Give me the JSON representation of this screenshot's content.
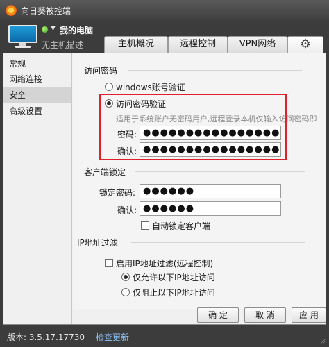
{
  "window": {
    "title": "向日葵被控端"
  },
  "header": {
    "host_name": "我的电脑",
    "host_desc": "无主机描述",
    "tabs": [
      {
        "label": "主机概况"
      },
      {
        "label": "远程控制"
      },
      {
        "label": "VPN网络"
      }
    ],
    "settings_icon": "gear-icon"
  },
  "sidebar": {
    "items": [
      {
        "label": "常规"
      },
      {
        "label": "网络连接"
      },
      {
        "label": "安全",
        "active": true
      },
      {
        "label": "高级设置"
      }
    ]
  },
  "access_password": {
    "section_title": "访问密码",
    "option_windows": "windows账号验证",
    "option_password": "访问密码验证",
    "hint": "适用于系统账户无密码用户,远程登录本机仅输入访问密码即",
    "password_label": "密码:",
    "password_value": "●●●●●●●●●●●●●●●●",
    "confirm_label": "确认:",
    "confirm_value": "●●●●●●●●●●●●●●●●"
  },
  "client_lock": {
    "section_title": "客户端锁定",
    "lock_password_label": "锁定密码:",
    "lock_password_value": "●●●●●●",
    "confirm_label": "确认:",
    "confirm_value": "●●●●●●",
    "auto_lock_label": "自动锁定客户端"
  },
  "ip_filter": {
    "section_title": "IP地址过滤",
    "enable_label": "启用IP地址过滤(远程控制)",
    "allow_only_label": "仅允许以下IP地址访问",
    "block_only_label": "仅阻止以下IP地址访问"
  },
  "buttons": {
    "ok": "确 定",
    "cancel": "取 消",
    "apply": "应 用"
  },
  "status": {
    "version": "版本: 3.5.17.17730",
    "update_link": "检查更新"
  },
  "colors": {
    "highlight": "#e0202c",
    "accent_link": "#8ec6ff"
  }
}
